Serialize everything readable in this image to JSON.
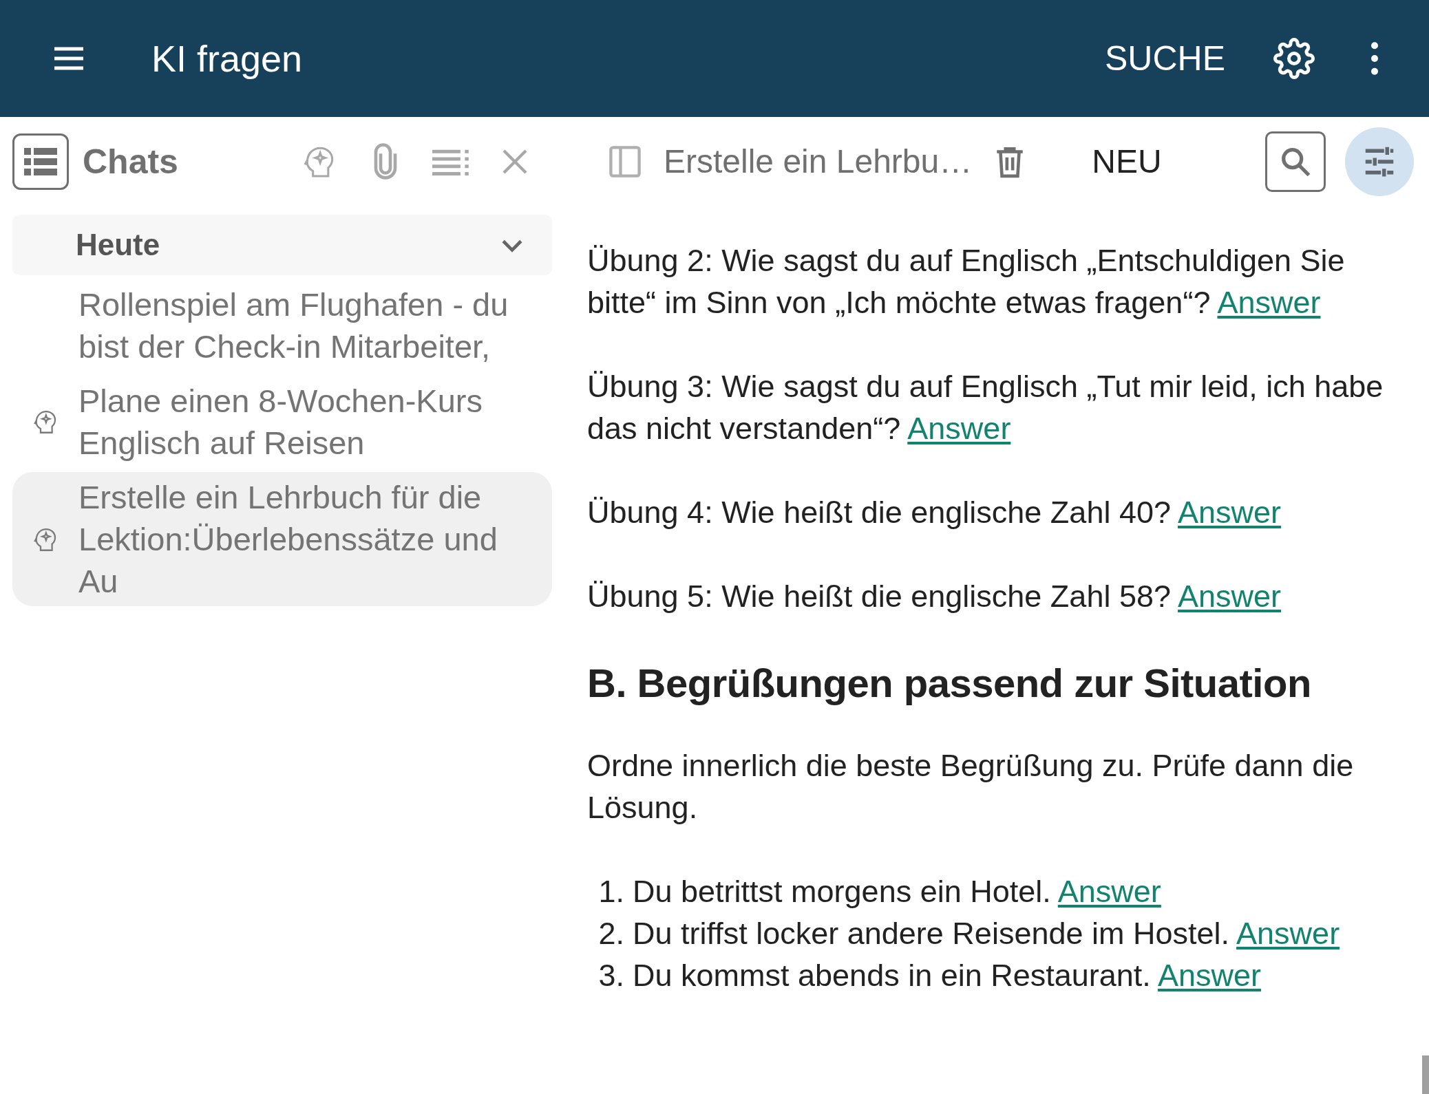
{
  "app_bar": {
    "title": "KI fragen",
    "search_label": "SUCHE"
  },
  "sidebar": {
    "title": "Chats",
    "group": {
      "label": "Heute",
      "expanded": true
    },
    "items": [
      {
        "text": "Rollenspiel am Flughafen - du bist der Check-in Mitarbeiter,",
        "kind": "plain",
        "selected": false
      },
      {
        "text": "Plane einen 8-Wochen-Kurs Englisch auf Reisen",
        "kind": "ai",
        "selected": false
      },
      {
        "text": "Erstelle ein Lehrbuch für die Lektion:Überlebenssätze und Au",
        "kind": "ai",
        "selected": true
      }
    ]
  },
  "chat_toolbar": {
    "title": "Erstelle ein Lehrbu…",
    "new_label": "NEU",
    "filter_active": true
  },
  "content": [
    {
      "kind": "paragraph",
      "text": "Übung 2: Wie sagst du auf Englisch „Entschuldigen Sie bitte“ im Sinn von „Ich möchte etwas fragen“?",
      "link": "Answer"
    },
    {
      "kind": "paragraph",
      "text": "Übung 3: Wie sagst du auf Englisch „Tut mir leid, ich habe das nicht verstanden“?",
      "link": "Answer"
    },
    {
      "kind": "paragraph",
      "text": "Übung 4: Wie heißt die englische Zahl 40?",
      "link": "Answer"
    },
    {
      "kind": "paragraph",
      "text": "Übung 5: Wie heißt die englische Zahl 58?",
      "link": "Answer"
    },
    {
      "kind": "heading",
      "text": "B. Begrüßungen passend zur Situation"
    },
    {
      "kind": "paragraph",
      "text": "Ordne innerlich die beste Begrüßung zu. Prüfe dann die Lösung."
    },
    {
      "kind": "list",
      "items": [
        {
          "number": "1.",
          "text": "Du betrittst morgens ein Hotel.",
          "link": "Answer"
        },
        {
          "number": "2.",
          "text": "Du triffst locker andere Reisende im Hostel.",
          "link": "Answer"
        },
        {
          "number": "3.",
          "text": "Du kommst abends in ein Restaurant.",
          "link": "Answer"
        }
      ]
    }
  ]
}
